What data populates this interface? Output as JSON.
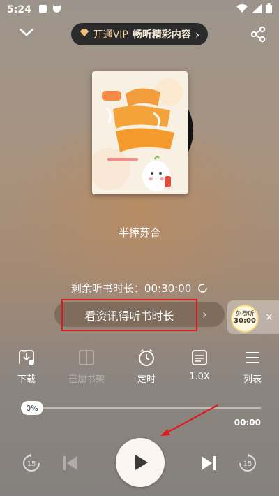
{
  "status": {
    "time": "5:24",
    "icons": [
      "square-icon",
      "cat-icon",
      "wifi-icon",
      "signal-icon",
      "battery-icon"
    ]
  },
  "header": {
    "vip_text": "开通VIP",
    "vip_sub": "畅听精彩内容",
    "vip_arrow": "›"
  },
  "book": {
    "author": "半捧苏合"
  },
  "remaining": {
    "label": "剩余听书时长：00:30:00"
  },
  "earn": {
    "label": "看资讯得听书时长",
    "arrow": "›"
  },
  "free_badge": {
    "line1": "免费听",
    "line2": "30:00",
    "close": "×"
  },
  "toolbar": {
    "items": [
      {
        "label": "下载",
        "icon": "download-icon",
        "enabled": true
      },
      {
        "label": "已加书架",
        "icon": "bookshelf-icon",
        "enabled": false
      },
      {
        "label": "定时",
        "icon": "timer-icon",
        "enabled": true
      },
      {
        "label": "1.0X",
        "icon": "speed-icon",
        "enabled": true
      },
      {
        "label": "列表",
        "icon": "list-icon",
        "enabled": true
      }
    ]
  },
  "player": {
    "progress_label": "0%",
    "progress": 0,
    "total_time": "00:00"
  },
  "colors": {
    "highlight_box": "#e0191c",
    "vip_pill_bg": "#2b2b2b",
    "vip_text": "#f2d3a7",
    "badge_ring": "#f6d57a"
  }
}
